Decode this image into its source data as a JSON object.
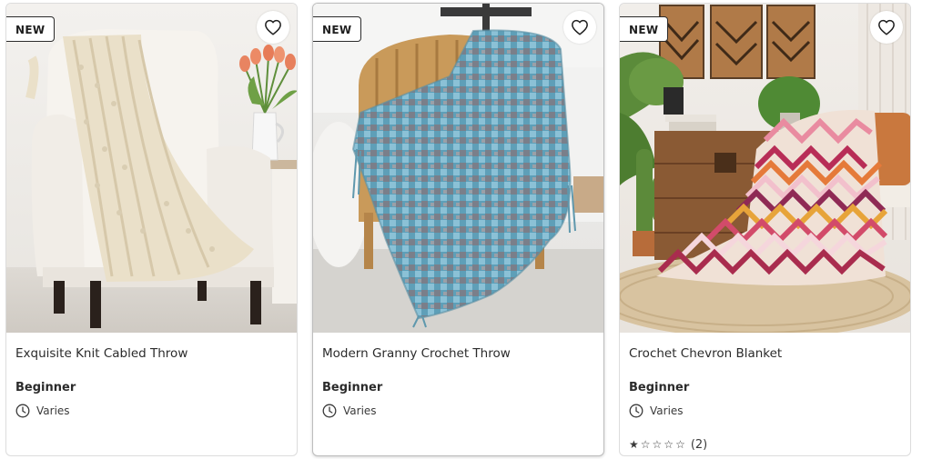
{
  "cards": [
    {
      "badge": "NEW",
      "title": "Exquisite Knit Cabled Throw",
      "skill_level": "Beginner",
      "time": "Varies",
      "favorite_icon": "heart-outline-icon"
    },
    {
      "badge": "NEW",
      "title": "Modern Granny Crochet Throw",
      "skill_level": "Beginner",
      "time": "Varies",
      "favorite_icon": "heart-outline-icon"
    },
    {
      "badge": "NEW",
      "title": "Crochet Chevron Blanket",
      "skill_level": "Beginner",
      "time": "Varies",
      "favorite_icon": "heart-outline-icon",
      "rating": {
        "stars_filled": 1,
        "stars_total": 5,
        "count_text": "(2)"
      }
    }
  ],
  "colors": {
    "border": "#dcdcdc",
    "text": "#2b2b2b",
    "badge_bg": "#ffffff"
  }
}
